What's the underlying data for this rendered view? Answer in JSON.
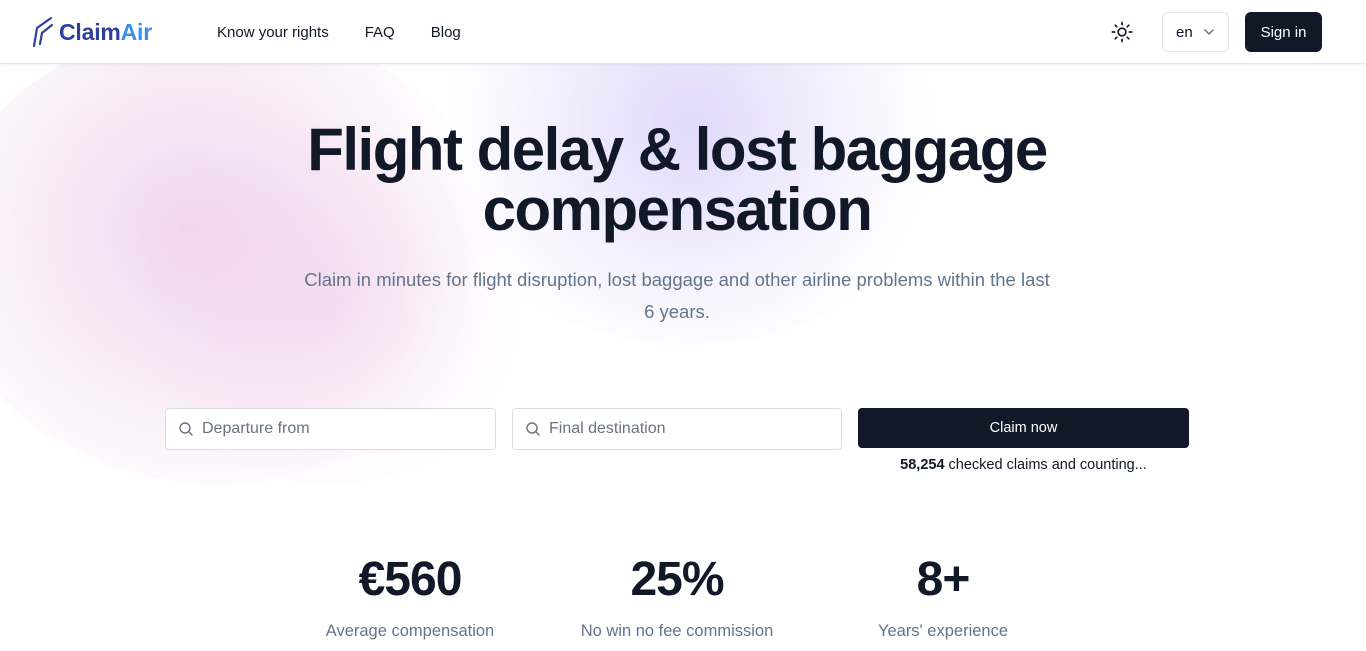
{
  "brand": {
    "name_part1": "Claim",
    "name_part2": "Air",
    "accent": "#3b8fe8",
    "dark": "#2f3f9e"
  },
  "nav": {
    "items": [
      {
        "label": "Know your rights"
      },
      {
        "label": "FAQ"
      },
      {
        "label": "Blog"
      }
    ]
  },
  "header": {
    "language": "en",
    "signin_label": "Sign in",
    "theme_icon": "sun-icon"
  },
  "hero": {
    "title": "Flight delay & lost baggage compensation",
    "subtitle": "Claim in minutes for flight disruption, lost baggage and other airline problems within the last 6 years."
  },
  "search": {
    "departure_placeholder": "Departure from",
    "destination_placeholder": "Final destination",
    "claim_label": "Claim now",
    "claims_count": "58,254",
    "claims_suffix": " checked claims and counting..."
  },
  "stats": [
    {
      "value": "€560",
      "label": "Average compensation"
    },
    {
      "value": "25%",
      "label": "No win no fee commission"
    },
    {
      "value": "8+",
      "label": "Years' experience"
    }
  ],
  "colors": {
    "primary_button": "#111827",
    "muted_text": "#64748b"
  }
}
